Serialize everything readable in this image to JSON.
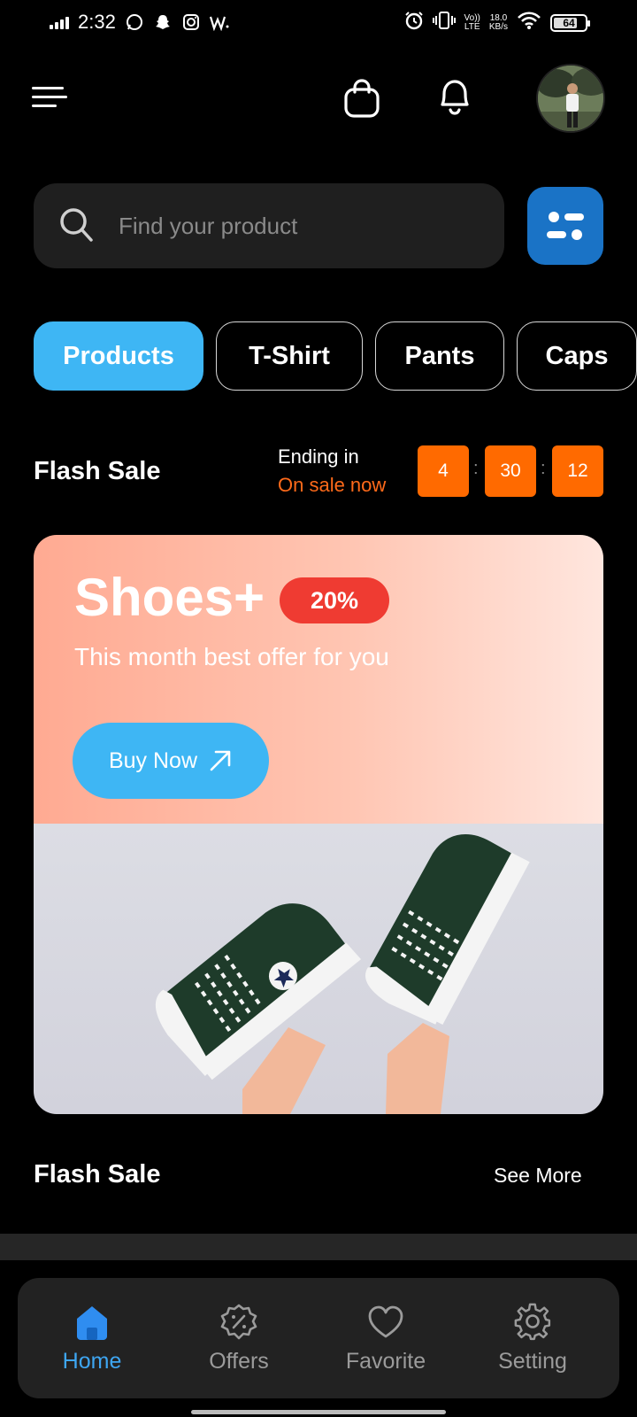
{
  "status_bar": {
    "time": "2:32",
    "app_icons": [
      "whatsapp-icon",
      "snapchat-icon",
      "instagram-icon",
      "w-icon"
    ],
    "network_label_top": "Vo))",
    "network_label_bottom": "LTE",
    "speed_value": "18.0",
    "speed_unit": "KB/s",
    "battery": "64"
  },
  "header": {
    "icons": [
      "menu-icon",
      "bag-icon",
      "bell-icon"
    ]
  },
  "search": {
    "placeholder": "Find your product",
    "value": ""
  },
  "categories": [
    {
      "label": "Products",
      "active": true
    },
    {
      "label": "T-Shirt",
      "active": false
    },
    {
      "label": "Pants",
      "active": false
    },
    {
      "label": "Caps",
      "active": false
    }
  ],
  "flash_sale": {
    "title": "Flash Sale",
    "ending_label": "Ending in",
    "status": "On sale now",
    "timer": {
      "hours": "4",
      "minutes": "30",
      "seconds": "12"
    }
  },
  "promo": {
    "title": "Shoes+",
    "discount": "20%",
    "subtitle": "This month best offer for you",
    "cta": "Buy Now"
  },
  "section2": {
    "title": "Flash Sale",
    "link": "See More"
  },
  "bottom_nav": [
    {
      "label": "Home",
      "icon": "home-icon",
      "active": true
    },
    {
      "label": "Offers",
      "icon": "discount-badge-icon",
      "active": false
    },
    {
      "label": "Favorite",
      "icon": "heart-icon",
      "active": false
    },
    {
      "label": "Setting",
      "icon": "gear-icon",
      "active": false
    }
  ],
  "colors": {
    "accent": "#3eb6f4",
    "timer": "#ff6a00",
    "badge": "#ef3b32",
    "filter_button": "#1a73c6"
  }
}
